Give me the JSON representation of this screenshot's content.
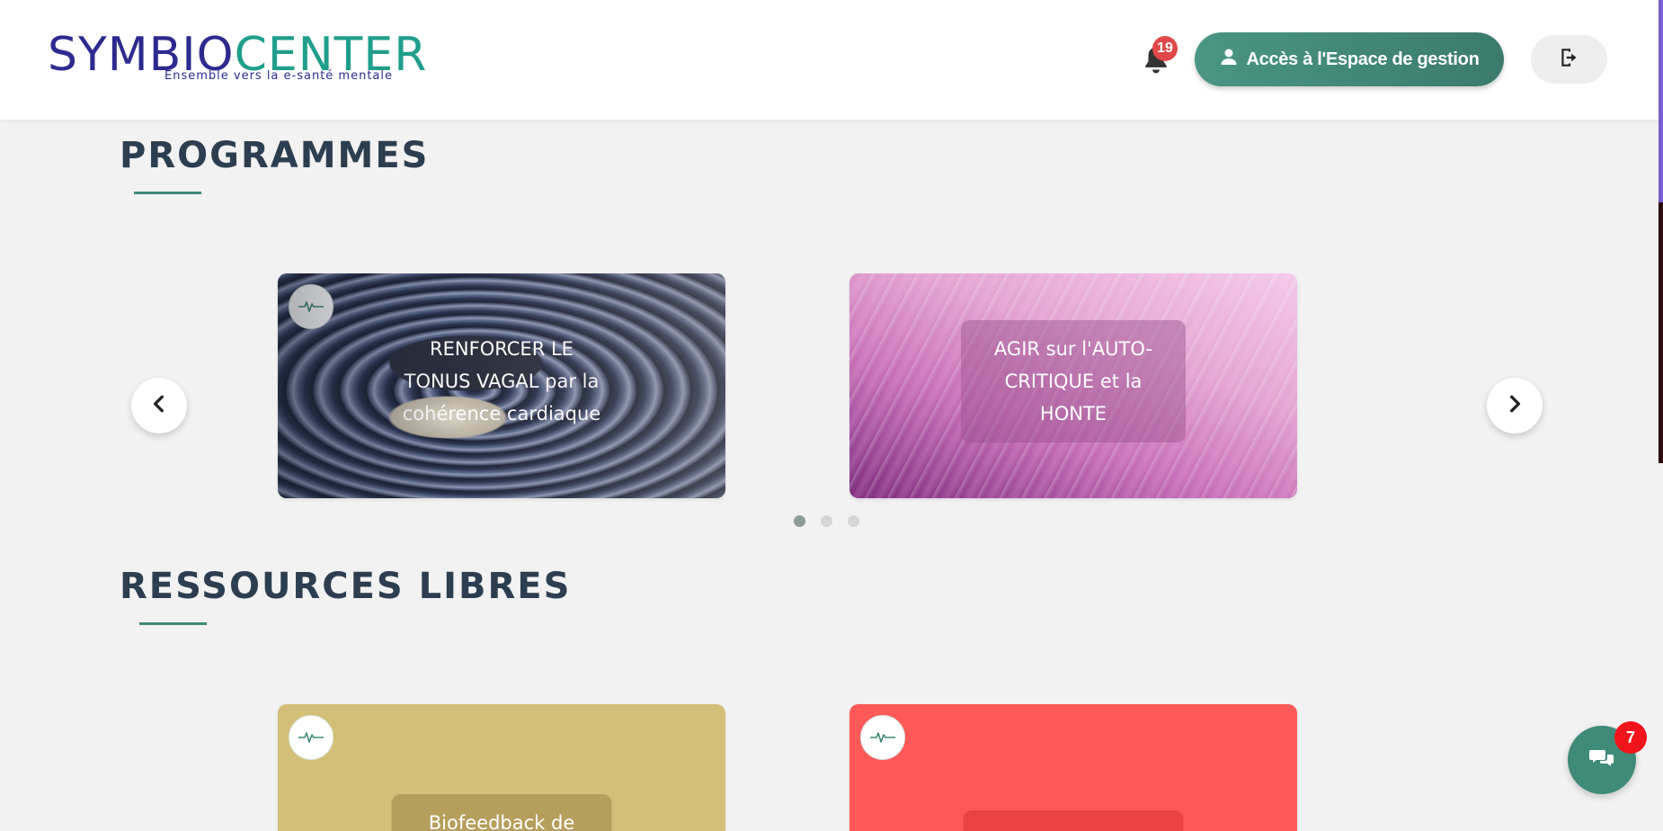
{
  "header": {
    "logo": {
      "part1": "SYMBIO",
      "part2": "CENTER",
      "tagline": "Ensemble vers la e-santé mentale"
    },
    "notifications": {
      "icon": "bell-icon",
      "count": "19"
    },
    "management_button": {
      "icon": "user-icon",
      "label": "Accès à l'Espace de gestion"
    },
    "logout_button": {
      "icon": "logout-icon"
    }
  },
  "programmes": {
    "title": "PROGRAMMES",
    "cards": [
      {
        "label": "RENFORCER LE TONUS VAGAL par la cohérence cardiaque",
        "icon": "pulse-icon"
      },
      {
        "label": "AGIR sur l'AUTO-CRITIQUE et la HONTE",
        "icon": "pulse-icon"
      }
    ],
    "dots": 3,
    "active_dot": 0
  },
  "ressources": {
    "title": "RESSOURCES LIBRES",
    "cards": [
      {
        "label": "Biofeedback de",
        "icon": "pulse-icon",
        "color": "#d4bf78"
      },
      {
        "label": "",
        "icon": "pulse-icon",
        "color": "#fe5959"
      }
    ]
  },
  "chat": {
    "icon": "chat-icon",
    "count": "7"
  },
  "colors": {
    "accent": "#3f8a78",
    "title": "#2c3e50",
    "logo_blue": "#2d2a8f",
    "logo_teal": "#1f9e8b"
  }
}
